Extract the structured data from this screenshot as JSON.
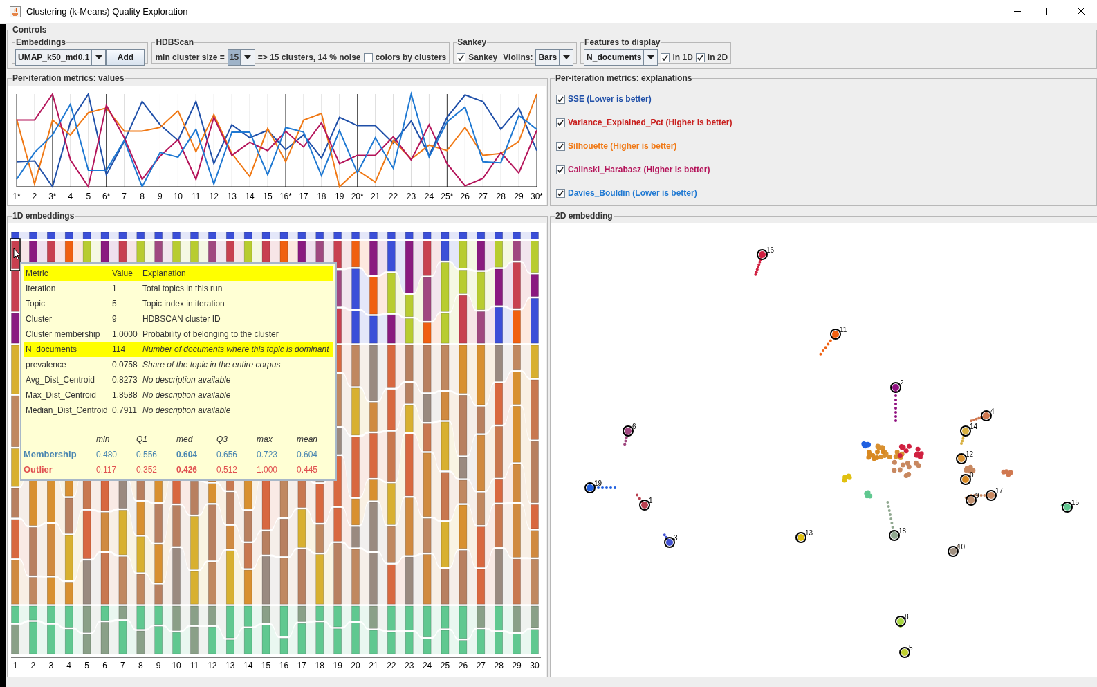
{
  "window": {
    "title": "Clustering (k-Means) Quality Exploration"
  },
  "controls": {
    "title": "Controls",
    "embeddings": {
      "title": "Embeddings",
      "value": "UMAP_k50_md0.1",
      "button": "Add"
    },
    "hdbscan": {
      "title": "HDBScan",
      "label": "min cluster size =",
      "value": "15",
      "result": "=> 15 clusters, 14 % noise",
      "colors_by_clusters": {
        "label": "colors by clusters",
        "checked": false
      }
    },
    "sankey": {
      "title": "Sankey",
      "sankey_checkbox": {
        "label": "Sankey",
        "checked": true
      },
      "violins_label": "Violins:",
      "violins_value": "Bars"
    },
    "features": {
      "title": "Features to display",
      "value": "N_documents",
      "in_1d": {
        "label": "in 1D",
        "checked": true
      },
      "in_2d": {
        "label": "in 2D",
        "checked": true
      }
    }
  },
  "metrics_values": {
    "title": "Per-iteration metrics: values",
    "x_labels": [
      "1*",
      "2",
      "3*",
      "4",
      "5",
      "6*",
      "7",
      "8",
      "9",
      "10",
      "11",
      "12",
      "13",
      "14",
      "15",
      "16*",
      "17",
      "18",
      "19",
      "20*",
      "21",
      "22",
      "23",
      "24",
      "25*",
      "26",
      "27",
      "28",
      "29",
      "30*"
    ]
  },
  "metrics_explanations": {
    "title": "Per-iteration metrics: explanations",
    "items": [
      {
        "label": "SSE (Lower is better)",
        "checked": true,
        "color": "#1f4fa8"
      },
      {
        "label": "Variance_Explained_Pct (Higher is better)",
        "checked": true,
        "color": "#c8201e"
      },
      {
        "label": "Silhouette (Higher is better)",
        "checked": true,
        "color": "#f07814"
      },
      {
        "label": "Calinski_Harabasz (Higher is better)",
        "checked": true,
        "color": "#b4145a"
      },
      {
        "label": "Davies_Bouldin (Lower is better)",
        "checked": true,
        "color": "#1e78d2"
      }
    ]
  },
  "embeddings_1d": {
    "title": "1D embeddings",
    "x_labels": [
      "1",
      "2",
      "3",
      "4",
      "5",
      "6",
      "7",
      "8",
      "9",
      "10",
      "11",
      "12",
      "13",
      "14",
      "15",
      "16",
      "17",
      "18",
      "19",
      "20",
      "21",
      "22",
      "23",
      "24",
      "25",
      "26",
      "27",
      "28",
      "29",
      "30"
    ],
    "tooltip": {
      "columns": [
        "Metric",
        "Value",
        "Explanation"
      ],
      "rows": [
        {
          "metric": "Iteration",
          "value": "1",
          "explanation": "Total topics in this run",
          "selected": false,
          "italic": false
        },
        {
          "metric": "Topic",
          "value": "5",
          "explanation": "Topic index in iteration",
          "selected": false,
          "italic": false
        },
        {
          "metric": "Cluster",
          "value": "9",
          "explanation": "HDBSCAN cluster ID",
          "selected": false,
          "italic": false
        },
        {
          "metric": "Cluster membership",
          "value": "1.0000",
          "explanation": "Probability of belonging to the cluster",
          "selected": false,
          "italic": false
        },
        {
          "metric": "N_documents",
          "value": "114",
          "explanation": "Number of documents where this topic is dominant",
          "selected": true,
          "italic": true
        },
        {
          "metric": "prevalence",
          "value": "0.0758",
          "explanation": "Share of the topic in the entire corpus",
          "selected": false,
          "italic": true
        },
        {
          "metric": "Avg_Dist_Centroid",
          "value": "0.8273",
          "explanation": "No description available",
          "selected": false,
          "italic": true
        },
        {
          "metric": "Max_Dist_Centroid",
          "value": "1.8588",
          "explanation": "No description available",
          "selected": false,
          "italic": true
        },
        {
          "metric": "Median_Dist_Centroid",
          "value": "0.7911",
          "explanation": "No description available",
          "selected": false,
          "italic": true
        }
      ],
      "stats": {
        "columns": [
          {
            "label": "min",
            "bold": false
          },
          {
            "label": "Q1",
            "bold": false
          },
          {
            "label": "med",
            "bold": true
          },
          {
            "label": "Q3",
            "bold": false
          },
          {
            "label": "max",
            "bold": false
          },
          {
            "label": "mean",
            "bold": false
          }
        ],
        "rows": [
          {
            "label": "Membership",
            "color": "#4a86b0",
            "values": [
              "0.480",
              "0.556",
              "0.604",
              "0.656",
              "0.723",
              "0.604"
            ]
          },
          {
            "label": "Outlier",
            "color": "#e05050",
            "values": [
              "0.117",
              "0.352",
              "0.426",
              "0.512",
              "1.000",
              "0.445"
            ]
          }
        ]
      }
    }
  },
  "embedding_2d": {
    "title": "2D embedding",
    "clusters": [
      {
        "label": "16",
        "color": "#d02040"
      },
      {
        "label": "11",
        "color": "#f06010"
      },
      {
        "label": "2",
        "color": "#901080"
      },
      {
        "label": "4",
        "color": "#d07850"
      },
      {
        "label": "14",
        "color": "#d8b040"
      },
      {
        "label": "6",
        "color": "#a04880"
      },
      {
        "label": "12",
        "color": "#d89030"
      },
      {
        "label": "0",
        "color": "#d88820"
      },
      {
        "label": "19",
        "color": "#2060e0"
      },
      {
        "label": "1",
        "color": "#b84050"
      },
      {
        "label": "17",
        "color": "#c88860"
      },
      {
        "label": "9",
        "color": "#c09070"
      },
      {
        "label": "15",
        "color": "#60c890"
      },
      {
        "label": "3",
        "color": "#4050d0"
      },
      {
        "label": "13",
        "color": "#e0c010"
      },
      {
        "label": "18",
        "color": "#90a890"
      },
      {
        "label": "10",
        "color": "#a09080"
      },
      {
        "label": "8",
        "color": "#a8d840"
      },
      {
        "label": "5",
        "color": "#c0d030"
      }
    ]
  }
}
